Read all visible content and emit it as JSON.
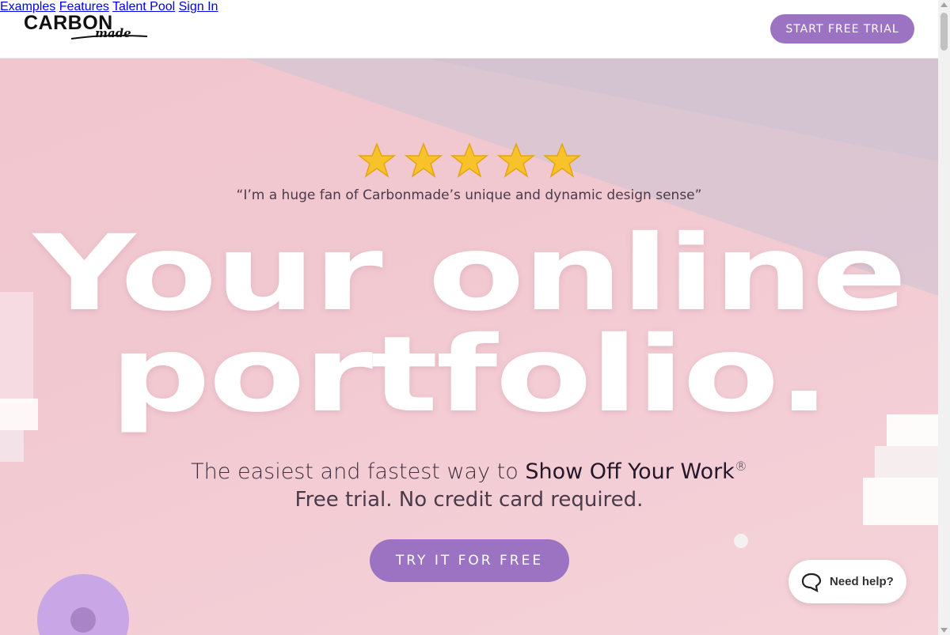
{
  "header": {
    "logo_main": "CARBON",
    "logo_sub": "made",
    "nav": [
      {
        "label": "Examples"
      },
      {
        "label": "Features"
      },
      {
        "label": "Talent Pool"
      },
      {
        "label": "Sign In"
      }
    ],
    "cta_label": "START FREE TRIAL"
  },
  "hero": {
    "rating_stars": 5,
    "quote": "“I’m a huge fan of Carbonmade’s unique and dynamic design sense”",
    "headline_line1": "Your online",
    "headline_line2": "portfolio.",
    "subtitle_prefix": "The easiest and fastest way to ",
    "subtitle_strong": "Show Off Your Work",
    "subtitle_mark": "®",
    "subtitle_line2": "Free trial. No credit card required.",
    "cta_label": "TRY IT FOR FREE"
  },
  "help_widget": {
    "label": "Need help?",
    "icon": "chat-bubble-icon"
  },
  "colors": {
    "accent": "#9b73c2",
    "hero_bg": "#f2c6cf",
    "headline": "#ffffff"
  }
}
